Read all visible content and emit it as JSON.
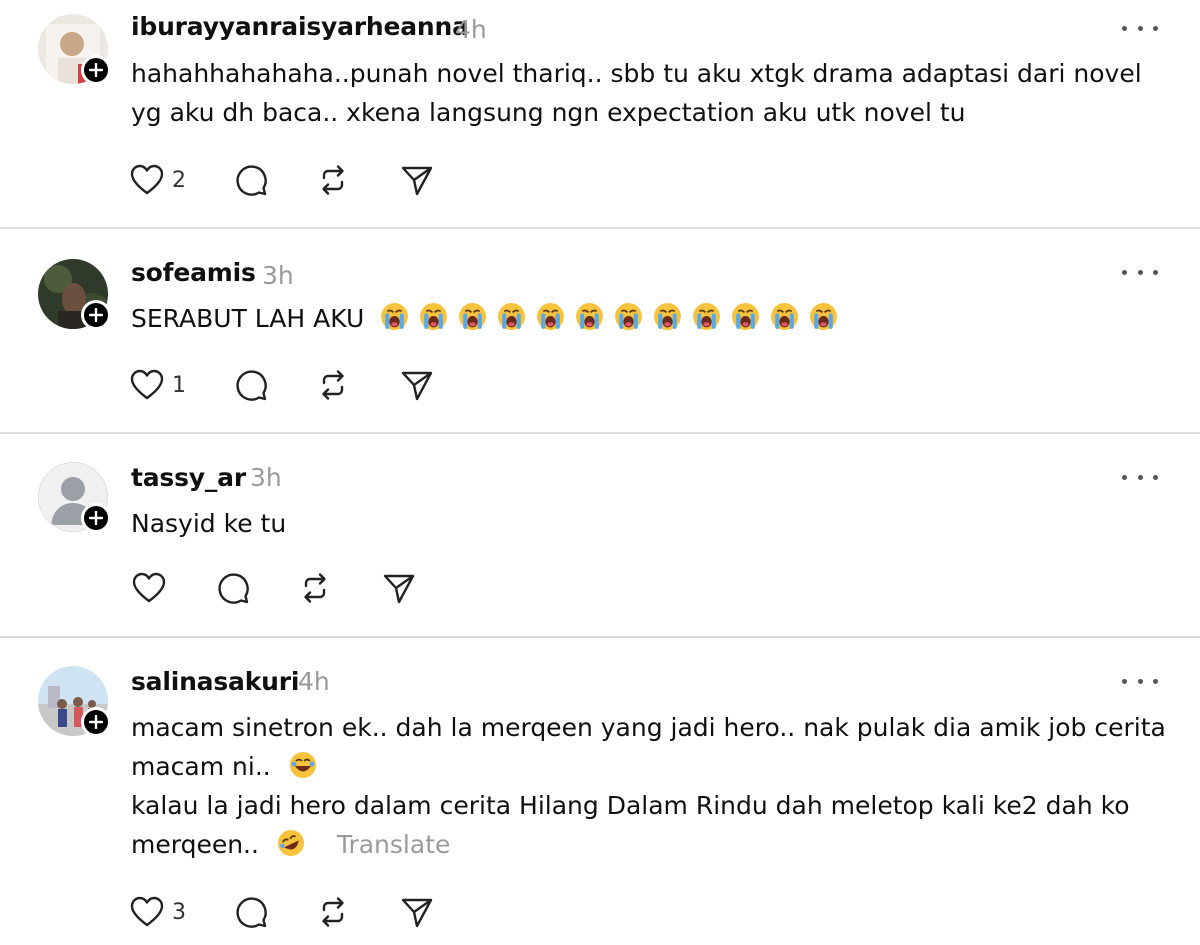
{
  "posts": [
    {
      "username": "iburayyanraisyarheanna",
      "time": "4h",
      "lines": [
        "hahahhahahaha..punah novel thariq.. sbb tu aku xtgk drama adaptasi dari novel",
        "yg aku dh baca.. xkena langsung ngn expectation aku utk novel tu"
      ],
      "likes": "2"
    },
    {
      "username": "sofeamis",
      "time": "3h",
      "text": "SERABUT LAH AKU",
      "emoji": "crying-face-emoji",
      "emoji_count": 12,
      "likes": "1"
    },
    {
      "username": "tassy_ar",
      "time": "3h",
      "text": "Nasyid ke tu",
      "likes": ""
    },
    {
      "username": "salinasakuri",
      "time": "4h",
      "lines": [
        "macam sinetron ek.. dah la merqeen yang jadi hero.. nak pulak dia amik job cerita",
        "macam ni..",
        "kalau la jadi hero dalam cerita Hilang Dalam Rindu dah meletop kali ke2 dah ko",
        "merqeen.."
      ],
      "translate": "Translate",
      "likes": "3"
    }
  ],
  "colors": {
    "separator": "#dcdcdc",
    "muted": "#9a9a9a",
    "text": "#101010"
  },
  "icons": [
    "heart-icon",
    "comment-icon",
    "repost-icon",
    "share-icon",
    "more-icon",
    "follow-plus-icon"
  ]
}
